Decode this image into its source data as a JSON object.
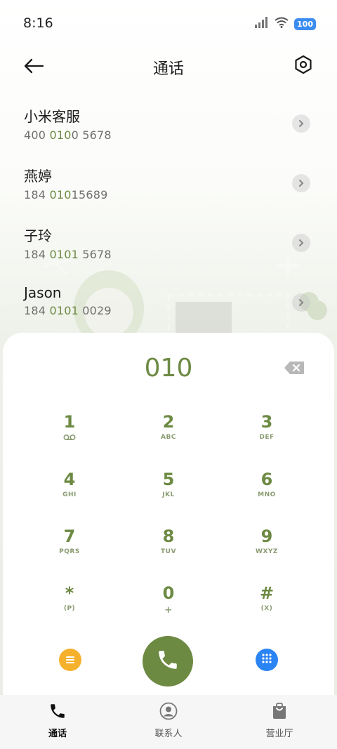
{
  "status_bar": {
    "time": "8:16",
    "battery": "100",
    "icons": [
      "signal-icon",
      "wifi-icon",
      "battery-icon"
    ]
  },
  "header": {
    "title": "通话",
    "back_icon": "arrow-left-icon",
    "settings_icon": "hexagon-settings-icon"
  },
  "contacts": [
    {
      "name": "小米客服",
      "number_pre": "400 ",
      "number_match": "010",
      "number_post": "0 5678"
    },
    {
      "name": "燕婷",
      "number_pre": "184 ",
      "number_match": "010",
      "number_post": "15689"
    },
    {
      "name": "子玲",
      "number_pre": "184 ",
      "number_match": "0101",
      "number_post": " 5678"
    },
    {
      "name": "Jason",
      "number_pre": "184 ",
      "number_match": "0101",
      "number_post": " 0029"
    }
  ],
  "dialer": {
    "input": "010",
    "keys": [
      {
        "digit": "1",
        "sub": ""
      },
      {
        "digit": "2",
        "sub": "ABC"
      },
      {
        "digit": "3",
        "sub": "DEF"
      },
      {
        "digit": "4",
        "sub": "GHI"
      },
      {
        "digit": "5",
        "sub": "JKL"
      },
      {
        "digit": "6",
        "sub": "MNO"
      },
      {
        "digit": "7",
        "sub": "PQRS"
      },
      {
        "digit": "8",
        "sub": "TUV"
      },
      {
        "digit": "9",
        "sub": "WXYZ"
      },
      {
        "digit": "*",
        "sub": "(P)"
      },
      {
        "digit": "0",
        "sub": "+"
      },
      {
        "digit": "#",
        "sub": "(X)"
      }
    ]
  },
  "bottom_nav": [
    {
      "label": "通话",
      "active": true
    },
    {
      "label": "联系人",
      "active": false
    },
    {
      "label": "营业厅",
      "active": false
    }
  ],
  "colors": {
    "accent": "#6d8a43",
    "menu_button": "#f6b12c",
    "keypad_button": "#2a84f3",
    "battery": "#3b8cf0"
  }
}
